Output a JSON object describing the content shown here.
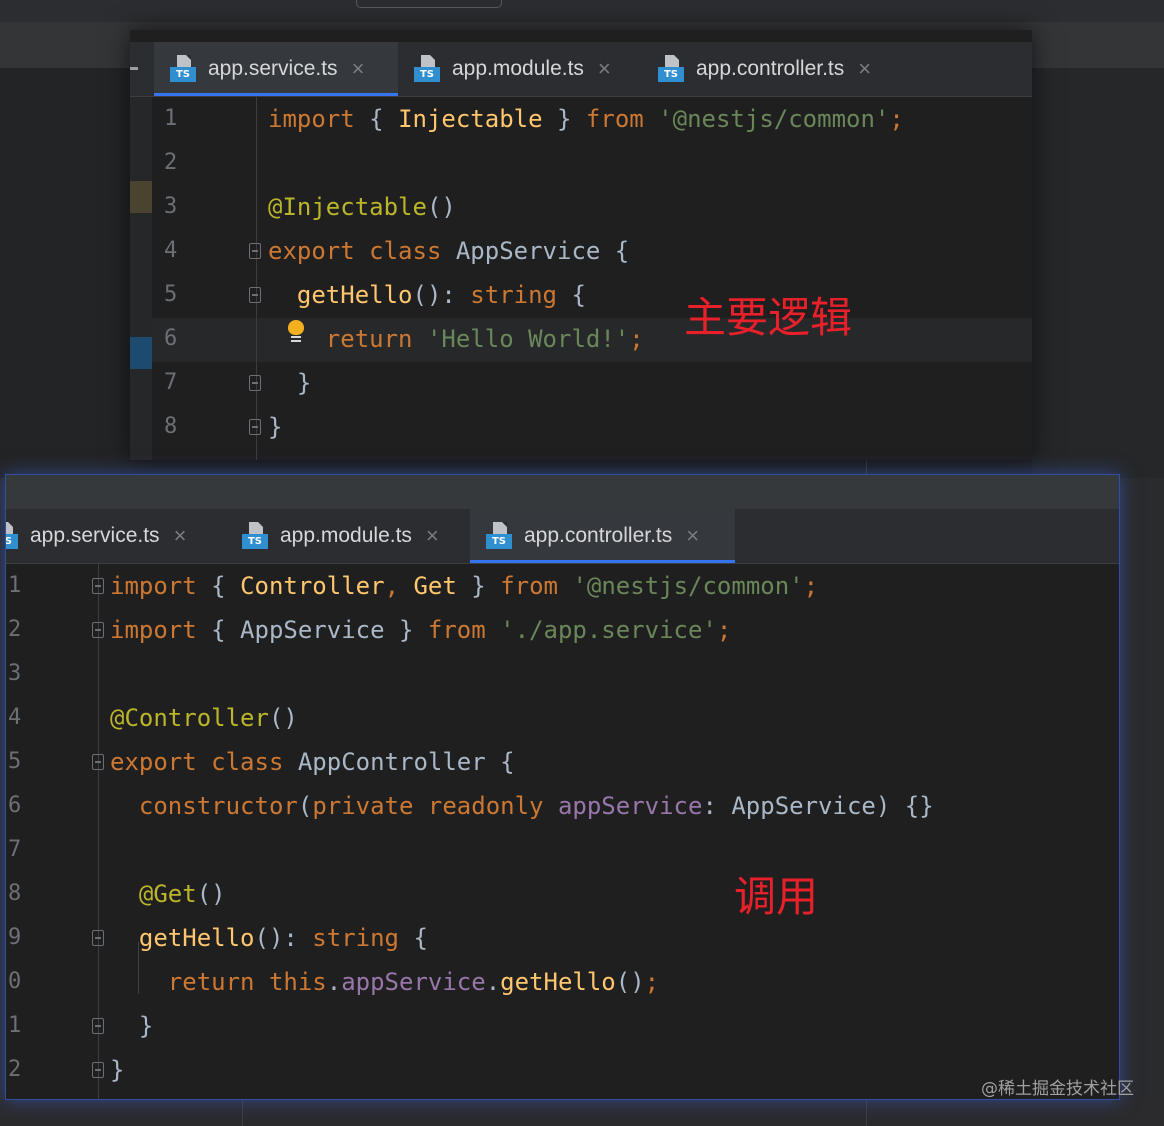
{
  "top_editor": {
    "tabs": [
      {
        "label": "app.service.ts",
        "badge": "TS",
        "active": true
      },
      {
        "label": "app.module.ts",
        "badge": "TS",
        "active": false
      },
      {
        "label": "app.controller.ts",
        "badge": "TS",
        "active": false
      }
    ],
    "line_numbers": [
      "1",
      "2",
      "3",
      "4",
      "5",
      "6",
      "7",
      "8"
    ],
    "lines": [
      [
        [
          "kw",
          "import"
        ],
        [
          "pl",
          " { "
        ],
        [
          "fn",
          "Injectable"
        ],
        [
          "pl",
          " } "
        ],
        [
          "kw",
          "from"
        ],
        [
          "pl",
          " "
        ],
        [
          "str",
          "'@nestjs/common'"
        ],
        [
          "kw",
          ";"
        ]
      ],
      [],
      [
        [
          "ann",
          "@Injectable"
        ],
        [
          "pl",
          "()"
        ]
      ],
      [
        [
          "kw",
          "export class "
        ],
        [
          "pl",
          "AppService {"
        ]
      ],
      [
        [
          "pl",
          "  "
        ],
        [
          "fn",
          "getHello"
        ],
        [
          "pl",
          "(): "
        ],
        [
          "kw",
          "string"
        ],
        [
          "pl",
          " {"
        ]
      ],
      [
        [
          "pl",
          "    "
        ],
        [
          "kw",
          "return"
        ],
        [
          "pl",
          " "
        ],
        [
          "str",
          "'Hello World!'"
        ],
        [
          "kw",
          ";"
        ]
      ],
      [
        [
          "pl",
          "  }"
        ]
      ],
      [
        [
          "pl",
          "}"
        ]
      ]
    ],
    "annotation": "主要逻辑"
  },
  "bottom_editor": {
    "tabs": [
      {
        "label": "app.service.ts",
        "badge": "TS",
        "active": false
      },
      {
        "label": "app.module.ts",
        "badge": "TS",
        "active": false
      },
      {
        "label": "app.controller.ts",
        "badge": "TS",
        "active": true
      }
    ],
    "line_numbers": [
      "1",
      "2",
      "3",
      "4",
      "5",
      "6",
      "7",
      "8",
      "9",
      "0",
      "1",
      "2"
    ],
    "lines": [
      [
        [
          "kw",
          "import"
        ],
        [
          "pl",
          " { "
        ],
        [
          "fn",
          "Controller"
        ],
        [
          "kw",
          ","
        ],
        [
          "pl",
          " "
        ],
        [
          "fn",
          "Get"
        ],
        [
          "pl",
          " } "
        ],
        [
          "kw",
          "from"
        ],
        [
          "pl",
          " "
        ],
        [
          "str",
          "'@nestjs/common'"
        ],
        [
          "kw",
          ";"
        ]
      ],
      [
        [
          "kw",
          "import"
        ],
        [
          "pl",
          " { AppService } "
        ],
        [
          "kw",
          "from"
        ],
        [
          "pl",
          " "
        ],
        [
          "str",
          "'./app.service'"
        ],
        [
          "kw",
          ";"
        ]
      ],
      [],
      [
        [
          "ann",
          "@Controller"
        ],
        [
          "pl",
          "()"
        ]
      ],
      [
        [
          "kw",
          "export class "
        ],
        [
          "pl",
          "AppController {"
        ]
      ],
      [
        [
          "pl",
          "  "
        ],
        [
          "kw",
          "constructor"
        ],
        [
          "pl",
          "("
        ],
        [
          "kw",
          "private readonly "
        ],
        [
          "fld",
          "appService"
        ],
        [
          "pl",
          ": AppService) {}"
        ]
      ],
      [],
      [
        [
          "pl",
          "  "
        ],
        [
          "ann",
          "@Get"
        ],
        [
          "pl",
          "()"
        ]
      ],
      [
        [
          "pl",
          "  "
        ],
        [
          "fn",
          "getHello"
        ],
        [
          "pl",
          "(): "
        ],
        [
          "kw",
          "string"
        ],
        [
          "pl",
          " {"
        ]
      ],
      [
        [
          "pl",
          "    "
        ],
        [
          "kw",
          "return this"
        ],
        [
          "pl",
          "."
        ],
        [
          "fld",
          "appService"
        ],
        [
          "pl",
          "."
        ],
        [
          "fn",
          "getHello"
        ],
        [
          "pl",
          "()"
        ],
        [
          "kw",
          ";"
        ]
      ],
      [
        [
          "pl",
          "  }"
        ]
      ],
      [
        [
          "pl",
          "}"
        ]
      ]
    ],
    "annotation": "调用"
  },
  "watermark": "@稀土掘金技术社区",
  "colors": {
    "keyword": "#cc7832",
    "string": "#6a8759",
    "function": "#ffc66d",
    "annotation": "#bbb529",
    "field": "#9876aa",
    "plain": "#a9b7c6",
    "note_red": "#e8202a",
    "tab_accent": "#3574f0"
  }
}
